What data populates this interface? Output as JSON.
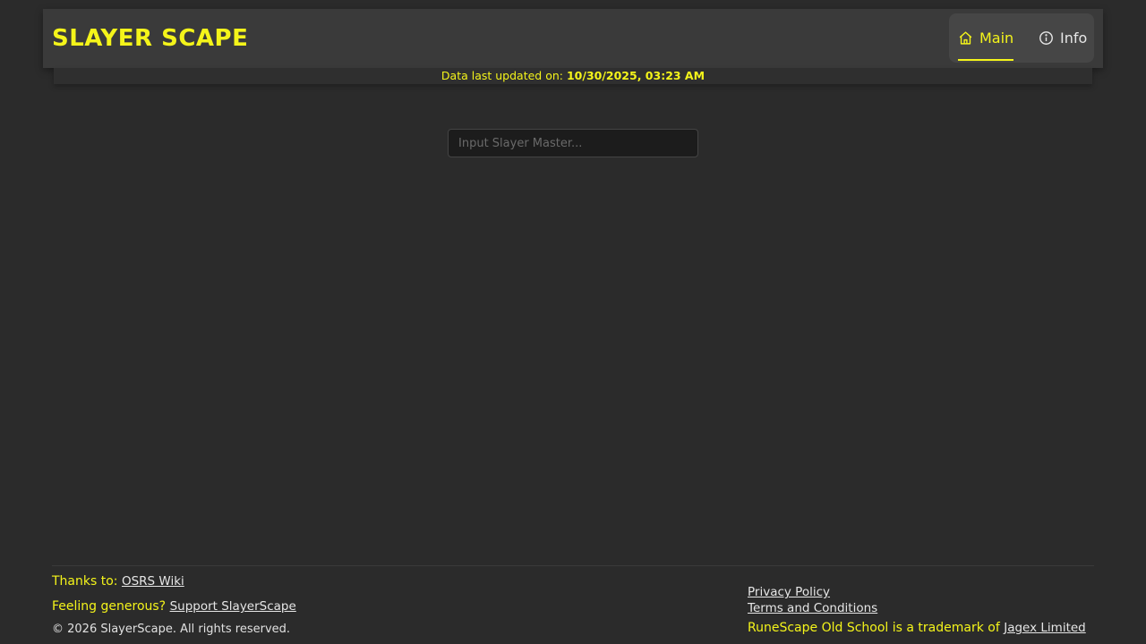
{
  "header": {
    "logo": "SLAYER SCAPE",
    "nav": {
      "main_label": "Main",
      "info_label": "Info"
    }
  },
  "status": {
    "prefix": "Data last updated on:",
    "timestamp": "10/30/2025, 03:23 AM"
  },
  "search": {
    "placeholder": "Input Slayer Master...",
    "value": ""
  },
  "footer": {
    "thanks_prefix": "Thanks to:",
    "thanks_link": "OSRS Wiki",
    "support_prefix": "Feeling generous?",
    "support_link": "Support SlayerScape",
    "copyright": "© 2026 SlayerScape. All rights reserved.",
    "privacy_link": "Privacy Policy",
    "terms_link": "Terms and Conditions",
    "trademark_prefix": "RuneScape Old School is a trademark of",
    "trademark_link": "Jagex Limited"
  },
  "colors": {
    "accent": "#f4f41a",
    "background": "#2b2b2b",
    "header": "#3a3a3a"
  },
  "icons": {
    "main": "home-icon",
    "info": "info-icon"
  }
}
